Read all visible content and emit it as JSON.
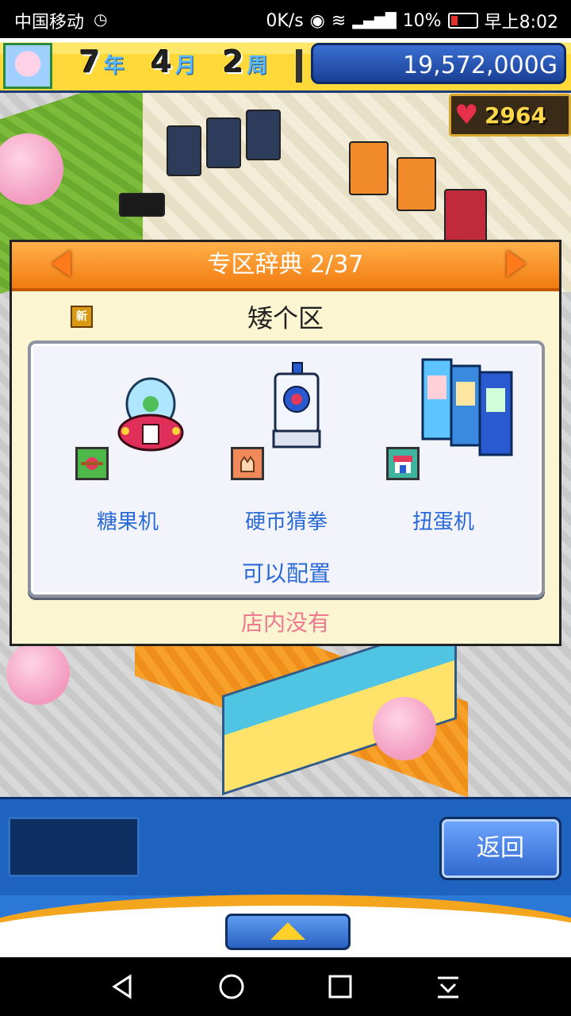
{
  "status_bar": {
    "carrier": "中国移动",
    "speed": "0K/s",
    "battery": "10%",
    "time": "早上8:02",
    "icons": [
      "clock-icon",
      "eye-icon",
      "wifi-icon",
      "signal-4g-icon",
      "battery-icon"
    ]
  },
  "hud": {
    "year": "7",
    "year_unit": "年",
    "month": "4",
    "month_unit": "月",
    "week": "2",
    "week_unit": "周",
    "money": "19,572,000G",
    "hearts": "2964"
  },
  "dialog": {
    "title": "专区辞典 2/37",
    "new_badge": "新",
    "zone_name": "矮个区",
    "items": [
      {
        "label": "糖果机",
        "art": "candy-machine-art",
        "icon": "candy-icon",
        "icon_color": "#4fb84a"
      },
      {
        "label": "硬币猜拳",
        "art": "coin-rps-machine-art",
        "icon": "hand-icon",
        "icon_color": "#f08a5a"
      },
      {
        "label": "扭蛋机",
        "art": "gacha-machine-art",
        "icon": "shop-icon",
        "icon_color": "#3fb5a0"
      }
    ],
    "placeable": "可以配置",
    "status": "店内没有"
  },
  "bottom": {
    "back_label": "返回"
  },
  "colors": {
    "header_orange": "#f27b10",
    "label_blue": "#2a6ad8",
    "status_pink": "#ef7a90",
    "panel_blue": "#1e63c0"
  }
}
